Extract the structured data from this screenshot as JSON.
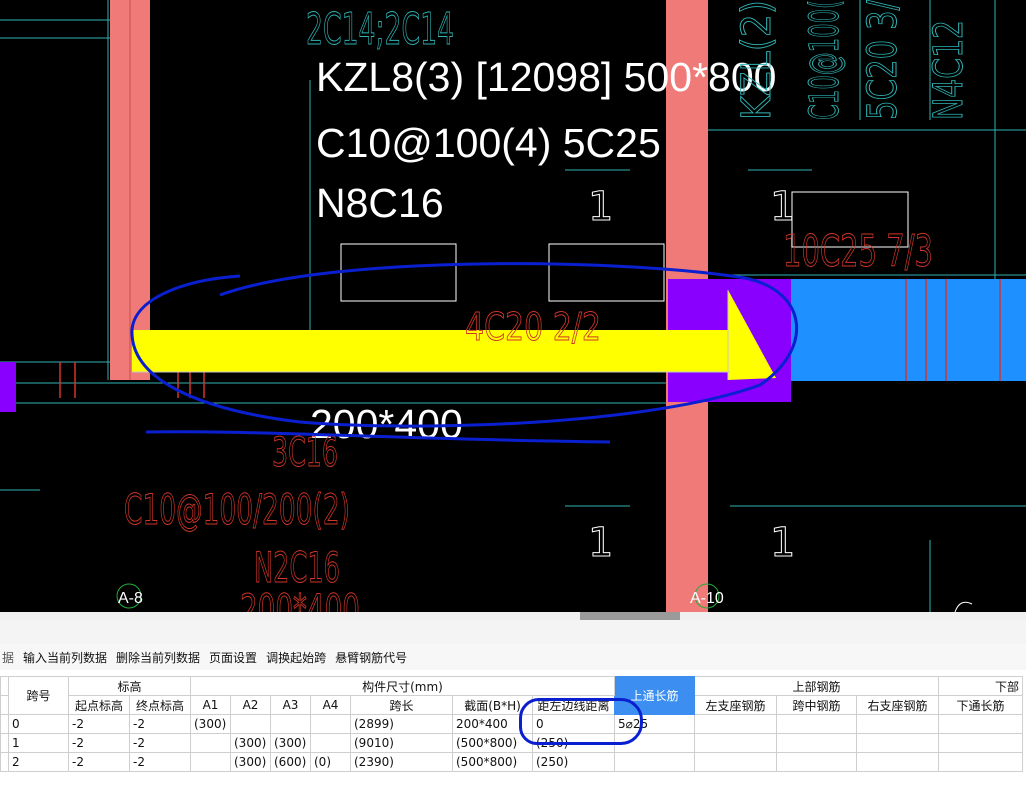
{
  "cad": {
    "beam_label": {
      "line1": "KZL8(3) [12098] 500*800",
      "line2": "C10@100(4) 5C25",
      "line3": "N8C16"
    },
    "section_label": "200*400",
    "top_left_rebar": "2C14;2C14",
    "vertical_right": [
      "KZL(2)",
      "C10@100(",
      "5C20 3/",
      "N4C12"
    ],
    "rebar_mid": "4C20 2/2",
    "rebar_right": "10C25 7/3",
    "rebar_bottom": [
      "3C16",
      "C10@100/200(2)",
      "N2C16",
      "200*400"
    ],
    "marks": [
      "1",
      "1",
      "1",
      "1"
    ],
    "axis_labels": [
      "A-8",
      "A-10"
    ],
    "colors": {
      "column": "#ef7a78",
      "beam_highlight": "#ffff00",
      "support": "#8a00ff",
      "beam_blue": "#1e90ff",
      "annotation": "#0a1fd0",
      "cad_text": "#ffffff",
      "cad_red": "#d0352a",
      "cad_cyan": "#2fb3b3"
    }
  },
  "toolbar": {
    "items": [
      "据",
      "输入当前列数据",
      "删除当前列数据",
      "页面设置",
      "调换起始跨",
      "悬臂钢筋代号"
    ]
  },
  "table": {
    "header_groups": {
      "span_no": "跨号",
      "elevation": "标高",
      "dims": "构件尺寸(mm)",
      "top_through": "上通长筋",
      "top_rebar": "上部钢筋",
      "bottom": "下部"
    },
    "sub_headers": [
      "起点标高",
      "终点标高",
      "A1",
      "A2",
      "A3",
      "A4",
      "跨长",
      "截面(B*H)",
      "距左边线距离",
      "左支座钢筋",
      "跨中钢筋",
      "右支座钢筋",
      "下通长筋"
    ],
    "rows": [
      [
        "0",
        "-2",
        "-2",
        "(300)",
        "",
        "",
        "",
        "(2899)",
        "200*400",
        "0",
        "5⌀25",
        "",
        "",
        "",
        ""
      ],
      [
        "1",
        "-2",
        "-2",
        "",
        "(300)",
        "(300)",
        "",
        "(9010)",
        "(500*800)",
        "(250)",
        "",
        "",
        "",
        "",
        ""
      ],
      [
        "2",
        "-2",
        "-2",
        "",
        "(300)",
        "(600)",
        "(0)",
        "(2390)",
        "(500*800)",
        "(250)",
        "",
        "",
        "",
        "",
        ""
      ]
    ]
  }
}
